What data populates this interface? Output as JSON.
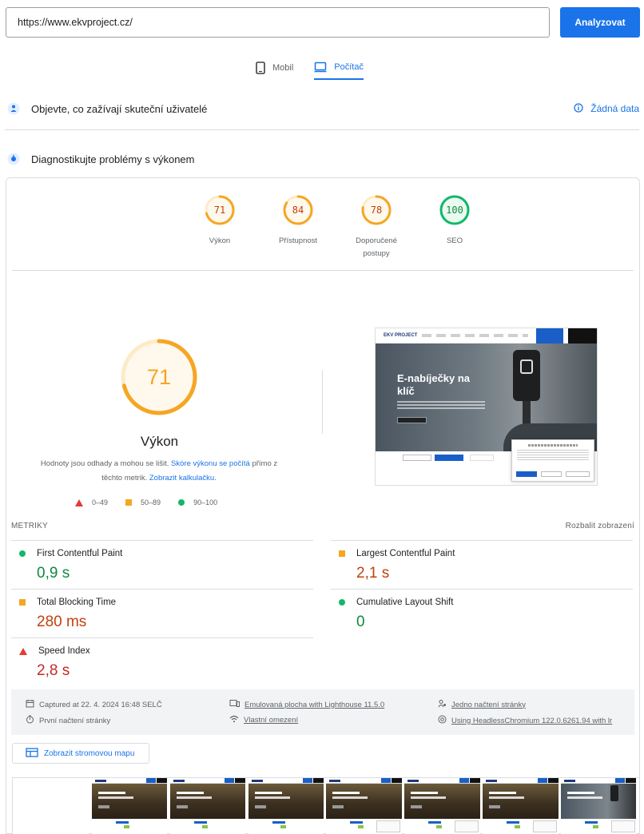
{
  "url_input": {
    "value": "https://www.ekvproject.cz/"
  },
  "analyze_button": "Analyzovat",
  "device_tabs": [
    {
      "label": "Mobil",
      "icon": "phone-icon",
      "active": false
    },
    {
      "label": "Počítač",
      "icon": "desktop-icon",
      "active": true
    }
  ],
  "field_data": {
    "title": "Objevte, co zažívají skuteční uživatelé",
    "no_data_label": "Žádná data"
  },
  "diagnose": {
    "title": "Diagnostikujte problémy s výkonem"
  },
  "scores": [
    {
      "value": "71",
      "label": "Výkon",
      "score": 71,
      "color": "#f5a623"
    },
    {
      "value": "84",
      "label": "Přístupnost",
      "score": 84,
      "color": "#f5a623"
    },
    {
      "value": "78",
      "label": "Doporučené postupy",
      "score": 78,
      "color": "#f5a623"
    },
    {
      "value": "100",
      "label": "SEO",
      "score": 100,
      "color": "#12b76a"
    }
  ],
  "performance": {
    "score": "71",
    "score_value": 71,
    "title": "Výkon",
    "desc_prefix": "Hodnoty jsou odhady a mohou se lišit.",
    "desc_link1": "Skóre výkonu se počítá",
    "desc_mid": "přímo z těchto metrik.",
    "desc_link2": "Zobrazit kalkulačku."
  },
  "legend": [
    {
      "range": "0–49",
      "shape": "triangle",
      "color": "#e53935"
    },
    {
      "range": "50–89",
      "shape": "square",
      "color": "#f5a623"
    },
    {
      "range": "90–100",
      "shape": "circle",
      "color": "#12b76a"
    }
  ],
  "screenshot": {
    "hero_title": "E-nabíječky na klíč",
    "logo": "EKV PROJECT"
  },
  "metrics_header": {
    "label": "METRIKY",
    "expand": "Rozbalit zobrazení"
  },
  "metrics": [
    {
      "name": "First Contentful Paint",
      "value": "0,9 s",
      "status": "good"
    },
    {
      "name": "Largest Contentful Paint",
      "value": "2,1 s",
      "status": "average"
    },
    {
      "name": "Total Blocking Time",
      "value": "280 ms",
      "status": "average"
    },
    {
      "name": "Cumulative Layout Shift",
      "value": "0",
      "status": "good"
    },
    {
      "name": "Speed Index",
      "value": "2,8 s",
      "status": "poor"
    }
  ],
  "run_info": {
    "captured": "Captured at 22. 4. 2024 16:48 SELČ",
    "emulated": "Emulovaná plocha with Lighthouse 11.5.0",
    "single_load": "Jedno načtení stránky",
    "initial_load": "První načtení stránky",
    "throttling": "Vlastní omezení",
    "browser": "Using HeadlessChromium 122.0.6261.94 with lr"
  },
  "treemap_button": "Zobrazit stromovou mapu"
}
